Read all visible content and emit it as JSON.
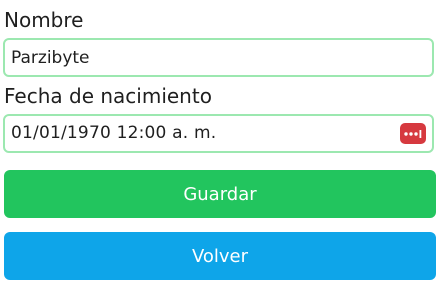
{
  "form": {
    "name_label": "Nombre",
    "name_value": "Parzibyte",
    "dob_label": "Fecha de nacimiento",
    "dob_value": "01/01/1970 12:00 a. m.",
    "dob_picker_icon": "calendar-picker-icon"
  },
  "buttons": {
    "save_label": "Guardar",
    "back_label": "Volver"
  },
  "colors": {
    "field_border": "#9ce8b0",
    "save_button": "#22c55e",
    "back_button": "#0ea5e9",
    "picker_icon": "#d6393f"
  }
}
